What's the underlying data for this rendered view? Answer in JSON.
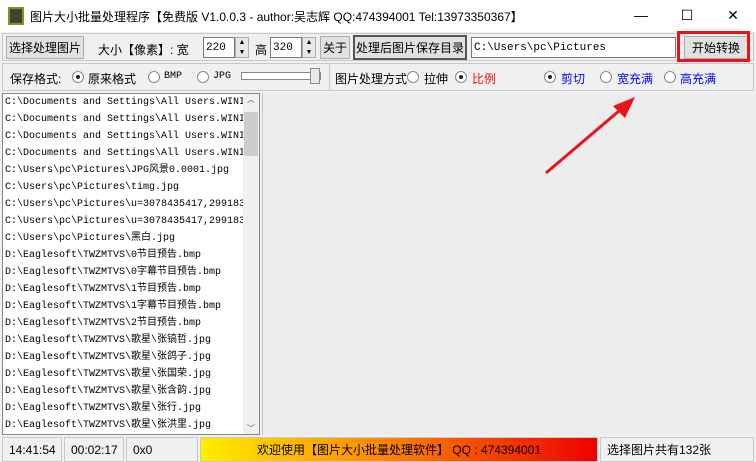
{
  "window": {
    "title": "图片大小批量处理程序【免费版 V1.0.0.3 - author:吴志辉  QQ:474394001 Tel:13973350367】",
    "minimize": "—",
    "maximize": "☐",
    "close": "✕"
  },
  "toolbar": {
    "select_images": "选择处理图片",
    "size_label": "大小【像素】: 宽",
    "width": "220",
    "height_label": "高",
    "height": "320",
    "about": "关于",
    "output_dir_button": "处理后图片保存目录",
    "output_dir": "C:\\Users\\pc\\Pictures",
    "start": "开始转换"
  },
  "format": {
    "label": "保存格式:",
    "options": [
      "原来格式",
      "BMP",
      "JPG"
    ],
    "selected": "原来格式"
  },
  "method": {
    "label": "图片处理方式",
    "options": [
      "拉伸",
      "比例"
    ],
    "selected": "比例",
    "crop_options": [
      "剪切",
      "宽充满",
      "高充满"
    ],
    "crop_selected": "剪切"
  },
  "files": [
    "C:\\Documents and Settings\\All Users.WINI",
    "C:\\Documents and Settings\\All Users.WINI",
    "C:\\Documents and Settings\\All Users.WINI",
    "C:\\Documents and Settings\\All Users.WINI",
    "C:\\Users\\pc\\Pictures\\JPG风景0.0001.jpg",
    "C:\\Users\\pc\\Pictures\\timg.jpg",
    "C:\\Users\\pc\\Pictures\\u=3078435417,299183",
    "C:\\Users\\pc\\Pictures\\u=3078435417,299183",
    "C:\\Users\\pc\\Pictures\\黑白.jpg",
    "D:\\Eaglesoft\\TWZMTVS\\0节目预告.bmp",
    "D:\\Eaglesoft\\TWZMTVS\\0字幕节目预告.bmp",
    "D:\\Eaglesoft\\TWZMTVS\\1节目预告.bmp",
    "D:\\Eaglesoft\\TWZMTVS\\1字幕节目预告.bmp",
    "D:\\Eaglesoft\\TWZMTVS\\2节目预告.bmp",
    "D:\\Eaglesoft\\TWZMTVS\\歌星\\张镐哲.jpg",
    "D:\\Eaglesoft\\TWZMTVS\\歌星\\张鸽子.jpg",
    "D:\\Eaglesoft\\TWZMTVS\\歌星\\张国荣.jpg",
    "D:\\Eaglesoft\\TWZMTVS\\歌星\\张含韵.jpg",
    "D:\\Eaglesoft\\TWZMTVS\\歌星\\张行.jpg",
    "D:\\Eaglesoft\\TWZMTVS\\歌星\\张洪里.jpg"
  ],
  "status": {
    "time": "14:41:54",
    "elapsed": "00:02:17",
    "dims": "0x0",
    "banner": "欢迎使用【图片大小批量处理软件】 QQ : 474394001",
    "count": "选择图片共有132张"
  },
  "colors": {
    "highlight": "#e8141a",
    "blue_option": "#0000ff"
  }
}
